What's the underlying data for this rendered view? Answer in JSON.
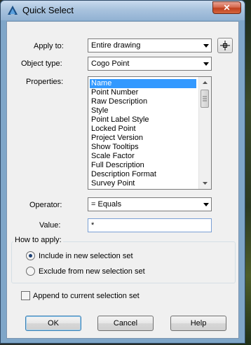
{
  "window": {
    "title": "Quick Select",
    "close_glyph": "✕"
  },
  "fields": {
    "apply_to": {
      "label": "Apply to:",
      "value": "Entire drawing"
    },
    "object_type": {
      "label": "Object type:",
      "value": "Cogo Point"
    },
    "properties": {
      "label": "Properties:",
      "items": [
        "Name",
        "Point Number",
        "Raw Description",
        "Style",
        "Point Label Style",
        "Locked Point",
        "Project Version",
        "Show Tooltips",
        "Scale Factor",
        "Full Description",
        "Description Format",
        "Survey Point"
      ],
      "selected_index": 0
    },
    "operator": {
      "label": "Operator:",
      "value": "= Equals"
    },
    "value": {
      "label": "Value:",
      "value": "*"
    }
  },
  "how_to_apply": {
    "title": "How to apply:",
    "options": [
      {
        "label": "Include in new selection set",
        "checked": true
      },
      {
        "label": "Exclude from new selection set",
        "checked": false
      }
    ]
  },
  "append": {
    "label": "Append to current selection set",
    "checked": false
  },
  "buttons": {
    "ok": "OK",
    "cancel": "Cancel",
    "help": "Help"
  },
  "colors": {
    "accent": "#3399ff",
    "title_bar": "#a9c3de",
    "close": "#c0401e"
  },
  "icons": {
    "app": "autocad-logo-icon",
    "pick": "crosshair-select-icon"
  }
}
